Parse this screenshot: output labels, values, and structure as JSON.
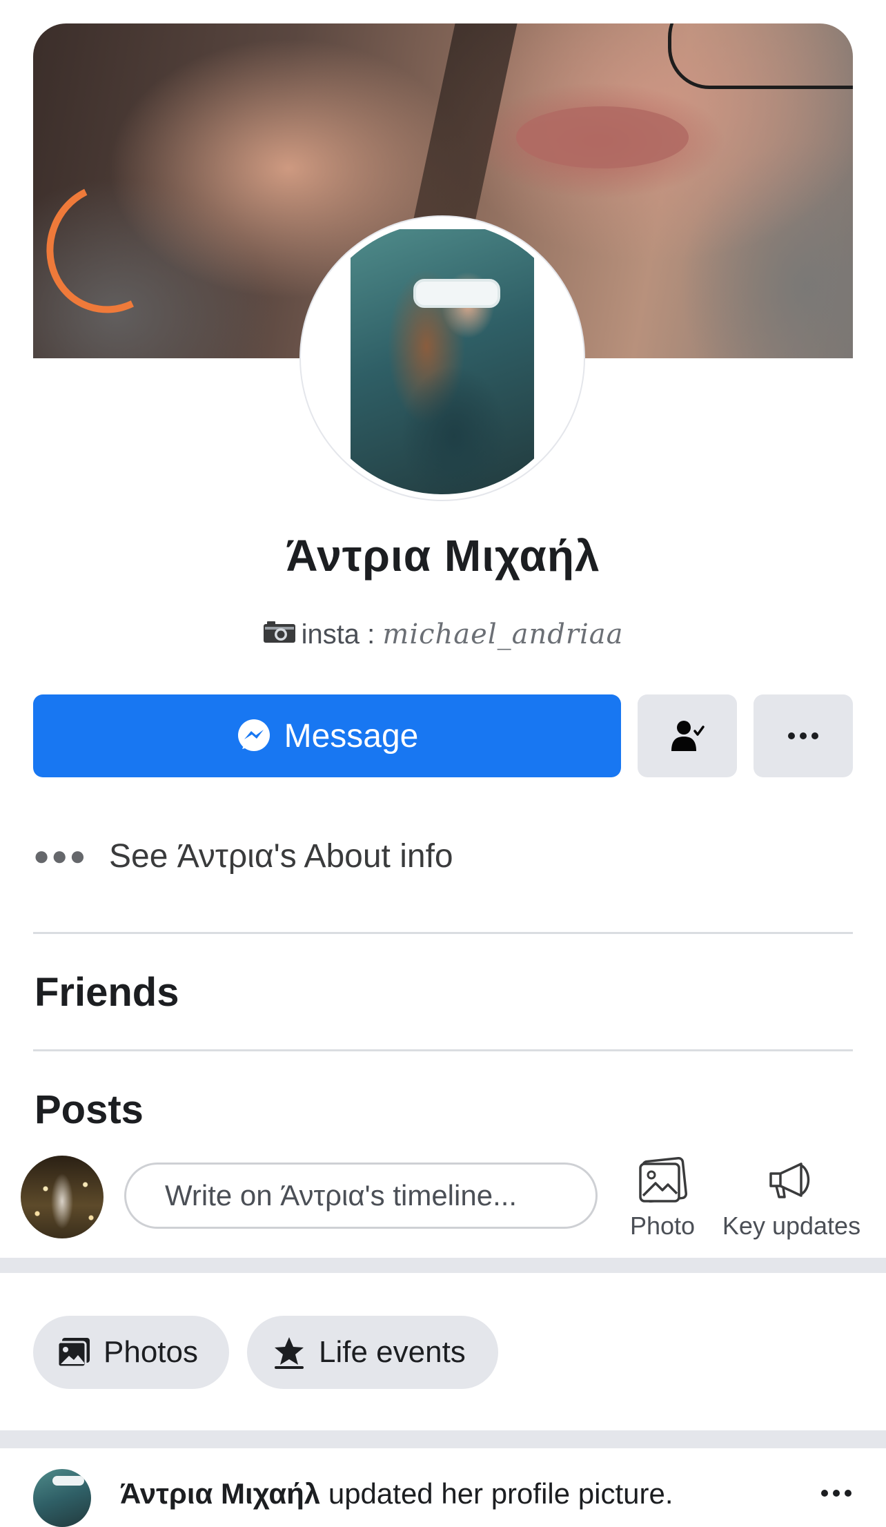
{
  "profile": {
    "name": "Άντρια Μιχαήλ",
    "bio_icon": "camera-emoji",
    "bio_prefix": "insta : ",
    "bio_handle": "michael_andriaa"
  },
  "actions": {
    "message_label": "Message",
    "friend_icon": "friend-check-icon",
    "more_icon": "more-icon"
  },
  "about": {
    "label": "See Άντρια's About info"
  },
  "sections": {
    "friends_title": "Friends",
    "posts_title": "Posts"
  },
  "composer": {
    "placeholder": "Write on Άντρια's timeline...",
    "photo_label": "Photo",
    "key_updates_label": "Key updates"
  },
  "filters": {
    "photos_label": "Photos",
    "life_events_label": "Life events"
  },
  "post": {
    "author": "Άντρια Μιχαήλ",
    "action_text": " updated her profile picture."
  },
  "colors": {
    "primary": "#1877f2",
    "button_gray": "#e4e6eb",
    "divider": "#dadde1",
    "text": "#1c1e21"
  }
}
